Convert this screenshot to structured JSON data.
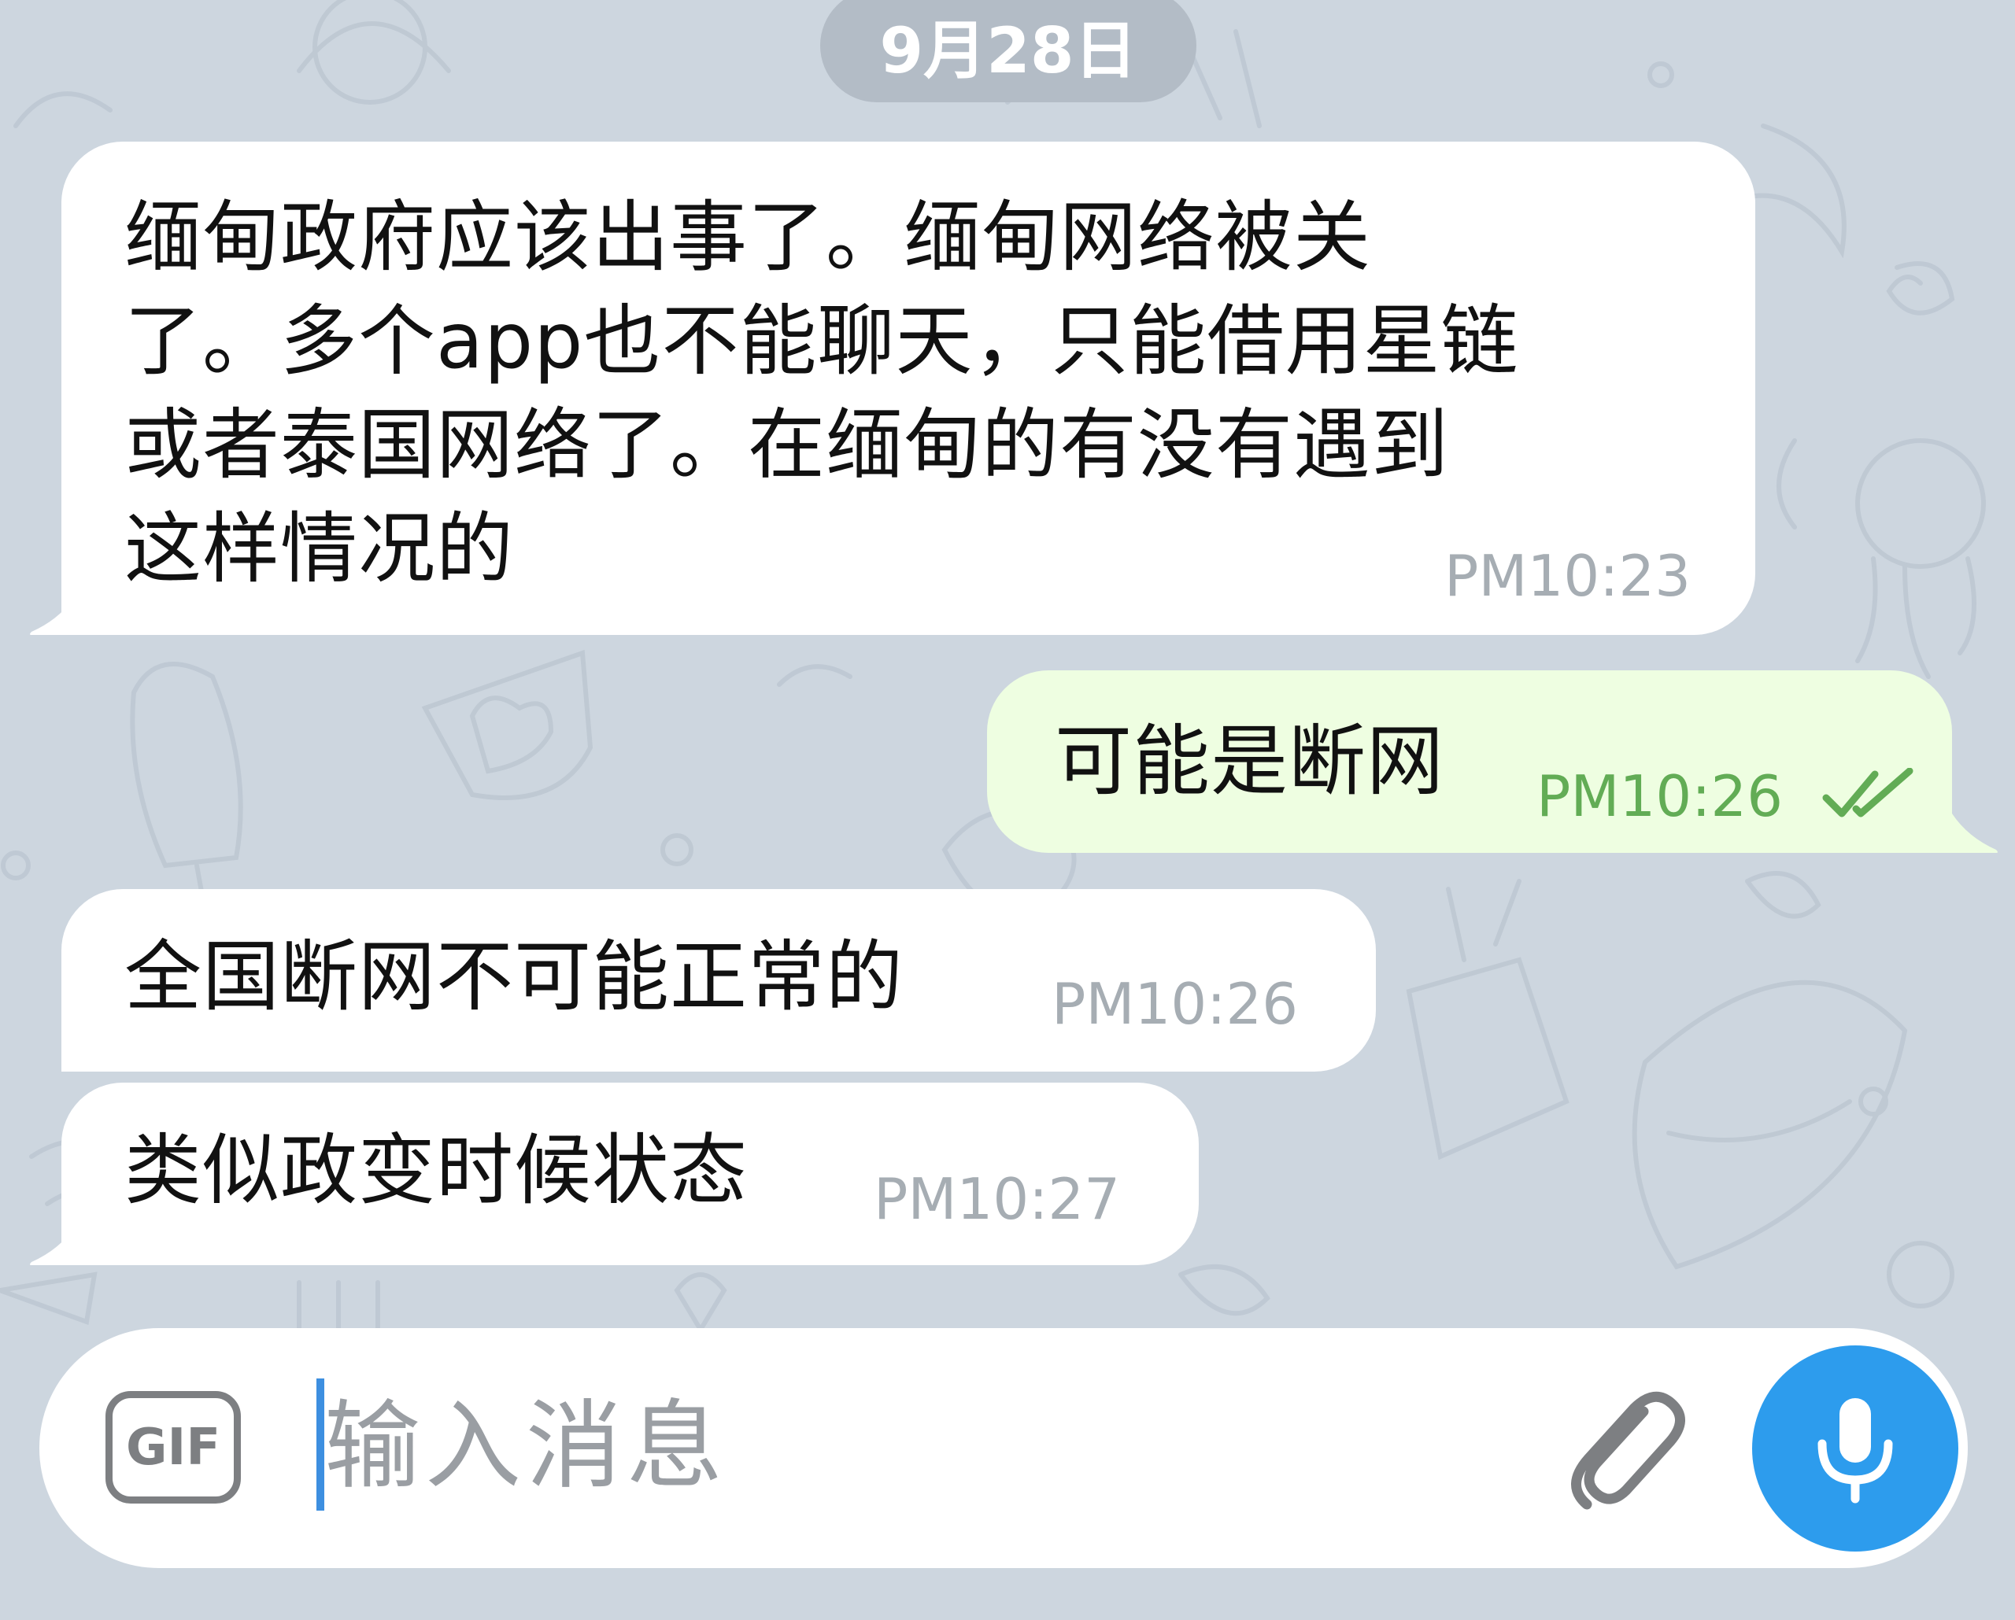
{
  "date_separator": "9月28日",
  "messages": [
    {
      "direction": "incoming",
      "lines": [
        "缅甸政府应该出事了。缅甸网络被关",
        "了。多个app也不能聊天，只能借用星链",
        "或者泰国网络了。在缅甸的有没有遇到",
        "这样情况的"
      ],
      "time": "PM10:23"
    },
    {
      "direction": "outgoing",
      "text": "可能是断网",
      "time": "PM10:26",
      "status": "read",
      "status_icon": "double-check-icon"
    },
    {
      "direction": "incoming",
      "text": "全国断网不可能正常的",
      "time": "PM10:26"
    },
    {
      "direction": "incoming",
      "text": "类似政变时候状态",
      "time": "PM10:27"
    }
  ],
  "composer": {
    "gif_label": "GIF",
    "placeholder": "输入消息",
    "value": "",
    "attach_icon": "paperclip-icon",
    "send_icon": "microphone-icon"
  },
  "colors": {
    "background": "#cdd6df",
    "incoming_bubble": "#ffffff",
    "outgoing_bubble": "#eefee1",
    "outgoing_time": "#62ac55",
    "incoming_time": "#a6adb3",
    "accent": "#2d9ced",
    "date_pill": "#b3bcc6"
  }
}
